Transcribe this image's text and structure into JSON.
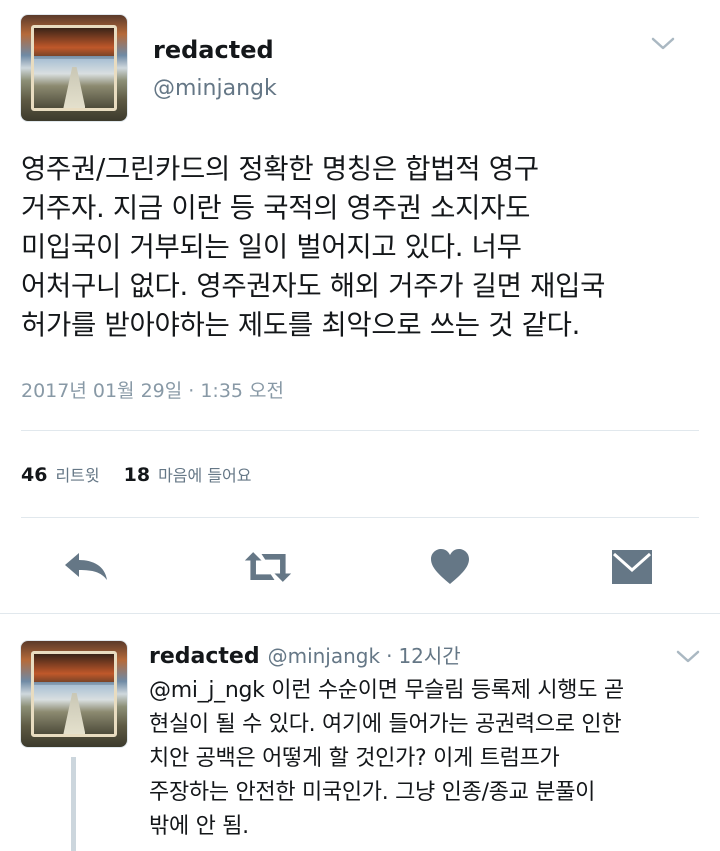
{
  "main_tweet": {
    "display_name": "redacted",
    "handle": "@minjangk",
    "text": "영주권/그린카드의 정확한 명칭은 합법적 영구\n거주자. 지금 이란 등 국적의 영주권 소지자도\n미입국이 거부되는 일이 벌어지고 있다. 너무\n어처구니 없다. 영주권자도 해외 거주가 길면 재입국\n허가를 받아야하는 제도를 최악으로 쓰는 것 같다.",
    "timestamp": "2017년 01월 29일 · 1:35 오전",
    "stats": {
      "retweets_count": "46",
      "retweets_label": "리트윗",
      "likes_count": "18",
      "likes_label": "마음에 들어요"
    },
    "actions": {
      "reply_icon": "reply-icon",
      "retweet_icon": "retweet-icon",
      "like_icon": "heart-icon",
      "dm_icon": "envelope-icon"
    }
  },
  "reply_tweet": {
    "display_name": "redacted",
    "handle": "@minjangk",
    "separator": "·",
    "time": "12시간",
    "text": "@mi_j_ngk 이런 수순이면 무슬림 등록제 시행도 곧\n현실이 될 수 있다. 여기에 들어가는 공권력으로 인한\n치안 공백은 어떻게 할 것인가? 이게 트럼프가\n주장하는 안전한 미국인가. 그냥 인종/종교 분풀이\n밖에 안 됨."
  },
  "colors": {
    "text_primary": "#14171a",
    "text_secondary": "#657786",
    "icon_gray": "#657786",
    "divider": "#e1e8ed"
  }
}
